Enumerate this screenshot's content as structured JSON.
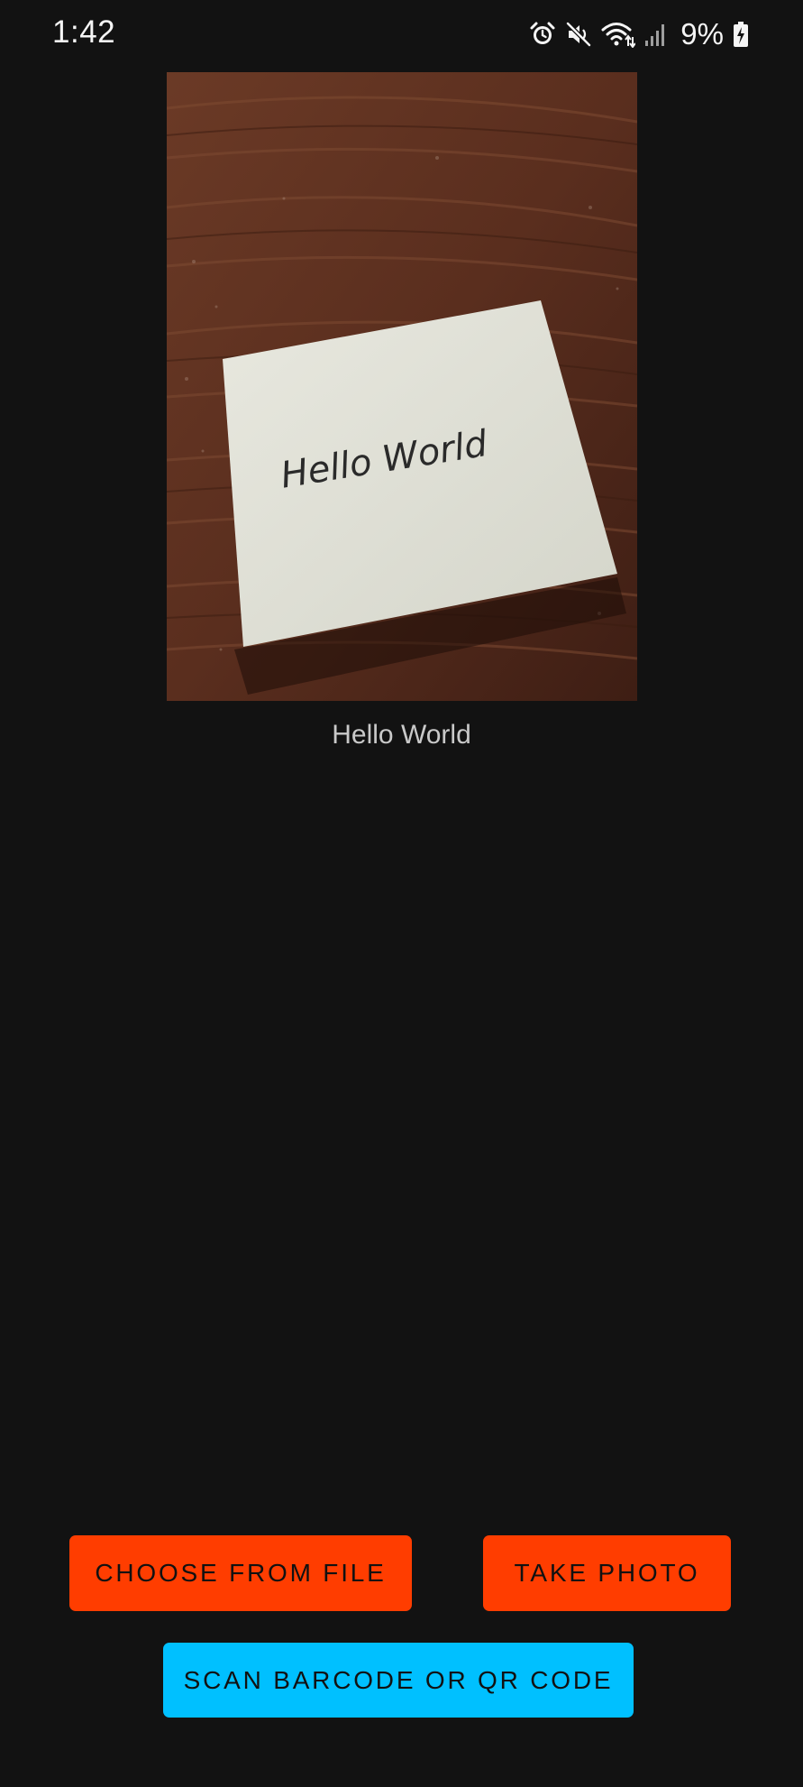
{
  "status_bar": {
    "time": "1:42",
    "battery_percent": "9%",
    "icons": [
      "alarm-icon",
      "mute-icon",
      "wifi-icon",
      "signal-icon",
      "battery-charging-icon"
    ]
  },
  "preview": {
    "image": "photo-of-handwritten-note",
    "handwritten_text": "Hello World",
    "recognized_text": "Hello World"
  },
  "actions": {
    "choose_from_file": "CHOOSE FROM FILE",
    "take_photo": "TAKE PHOTO",
    "scan_barcode": "SCAN BARCODE OR QR CODE"
  },
  "colors": {
    "background": "#121212",
    "primary_button": "#ff3d00",
    "secondary_button": "#00c0ff",
    "button_text": "#111111"
  }
}
